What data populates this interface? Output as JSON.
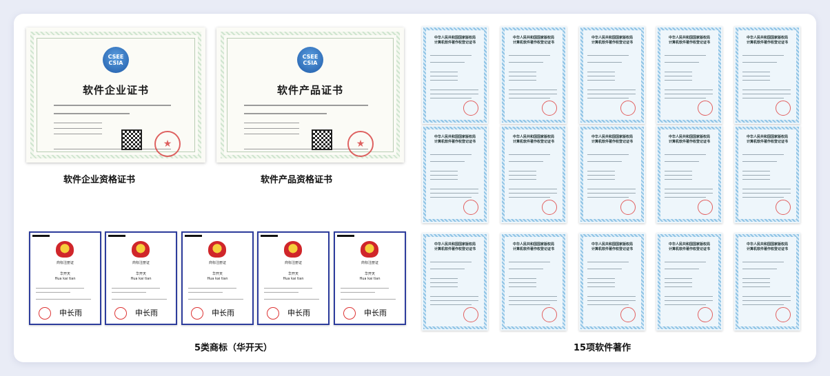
{
  "captions": {
    "software_enterprise": "软件企业资格证书",
    "software_product": "软件产品资格证书",
    "trademark": "5类商标（华开天）",
    "copyright": "15项软件著作"
  },
  "cert_enterprise": {
    "logo_top": "CSEE",
    "logo_bottom": "CSIA",
    "title": "软件企业证书"
  },
  "cert_product": {
    "logo_top": "CSEE",
    "logo_bottom": "CSIA",
    "title": "软件产品证书"
  },
  "trademark_cert": {
    "title": "商标注册证",
    "name_cn": "华开天",
    "name_en": "Hua kai tian",
    "signature": "申长雨"
  },
  "copyright_cert": {
    "heading": "中华人民共和国国家版权局\n计算机软件著作权登记证书"
  }
}
